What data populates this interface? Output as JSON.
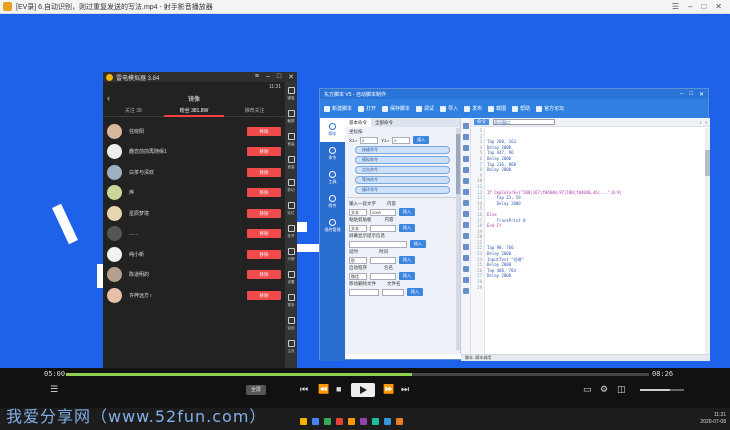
{
  "player": {
    "title": "[EV录] 6.自动识别，则过重复发送的写法.mp4 - 射手影音播放器",
    "time_current": "05:00",
    "time_total": "08:26",
    "progress": 0.594,
    "stop_label": "全屏",
    "colors": {
      "progress": "#8fd14f",
      "background": "#111111"
    }
  },
  "phone": {
    "window_title": "雷电模拟器 3.84",
    "status_time": "11:31",
    "header_title": "镜像",
    "tabs": [
      {
        "label": "关注 38",
        "active": false
      },
      {
        "label": "粉丝 381.8W",
        "active": true
      },
      {
        "label": "推荐关注",
        "active": false
      }
    ],
    "remove_label": "移除",
    "users": [
      {
        "name": "任晓阳"
      },
      {
        "name": "趣恋前前再随缘1"
      },
      {
        "name": "白茶与清欢"
      },
      {
        "name": "烨"
      },
      {
        "name": "星辰梦境"
      },
      {
        "name": "……"
      },
      {
        "name": "纯小新"
      },
      {
        "name": "陈道明的"
      },
      {
        "name": "许梓远方♀"
      }
    ],
    "side_buttons": [
      "键盘",
      "截屏",
      "音量",
      "音量",
      "剪切",
      "定位",
      "多开",
      "分辨",
      "设置",
      "更多",
      "返回",
      "主页"
    ]
  },
  "tool": {
    "title": "东方脚本 V5 - 自动脚本制作",
    "toolbar": [
      {
        "icon": "new-icon",
        "label": "新建脚本"
      },
      {
        "icon": "open-icon",
        "label": "打开"
      },
      {
        "icon": "save-icon",
        "label": "保存脚本"
      },
      {
        "icon": "search-icon",
        "label": "调试"
      },
      {
        "icon": "import-icon",
        "label": "导入"
      },
      {
        "icon": "publish-icon",
        "label": "发布"
      },
      {
        "icon": "photo-icon",
        "label": "截图"
      },
      {
        "icon": "help-icon",
        "label": "帮助"
      },
      {
        "icon": "user-icon",
        "label": "官方论坛"
      }
    ],
    "nav": [
      "脚本",
      "命令",
      "工具",
      "附件",
      "插件管理"
    ],
    "mid_tabs": [
      "基本命令",
      "全部命令"
    ],
    "sections": {
      "coord": "坐标按",
      "coord_x_label": "X1=",
      "coord_x": "0",
      "coord_y_label": "Y1=",
      "coord_y": "0",
      "insert": "插入",
      "pills": [
        "按键命令",
        "模拟命令",
        "点击命令",
        "等待命令",
        "循环命令"
      ],
      "input_text_label": "输入一段文字",
      "input_text_hint": "内容",
      "input_text_value": "2000",
      "text_type": "文本",
      "copy_label": "粘贴剪贴板",
      "copy_hint": "内容",
      "show_label": "屏幕显示提示信息",
      "delay_label": "延时",
      "delay_unit": "时间",
      "delay_value": "秒",
      "app_label": "启动程序",
      "app_hint": "包名",
      "app_value": "微信",
      "file_label": "移动删除文件",
      "file_hint": "文件名"
    },
    "editor": {
      "tab_label": "命令",
      "view_label": "显示窗口",
      "gutter": [
        "1",
        "2",
        "3",
        "4",
        "5",
        "6",
        "7",
        "8",
        "9",
        "10",
        "11",
        "12",
        "13",
        "14",
        "15",
        "16",
        "17",
        "18",
        "19",
        "20",
        "21",
        "22",
        "23",
        "24",
        "25",
        "26",
        "27",
        "28",
        "29"
      ],
      "lines": [
        "",
        "",
        "Tap 208, 163",
        "Delay 2000",
        "Tap 447, 96",
        "Delay 2000",
        "Tap 236, 868",
        "Delay 2000",
        "",
        "",
        "",
        "If CmpColorEx(\"208|167|f04040,97|180|f04040,46|...\",0.9)",
        "    Tap 23, 59",
        "    Delay 2000",
        "",
        "Else",
        "    TracePrint 0",
        "End If",
        "",
        "",
        "",
        "Tap 90, 766",
        "Delay 2000",
        "InputText \"任晓\"",
        "Delay 2000",
        "Tap 488, 764",
        "Delay 2000",
        "",
        ""
      ]
    },
    "status": "脚本: 脚本调用"
  },
  "taskbar": {
    "time": "11:31",
    "date": "2020-07-08"
  },
  "watermark": "我爱分享网（www.52fun.com）"
}
